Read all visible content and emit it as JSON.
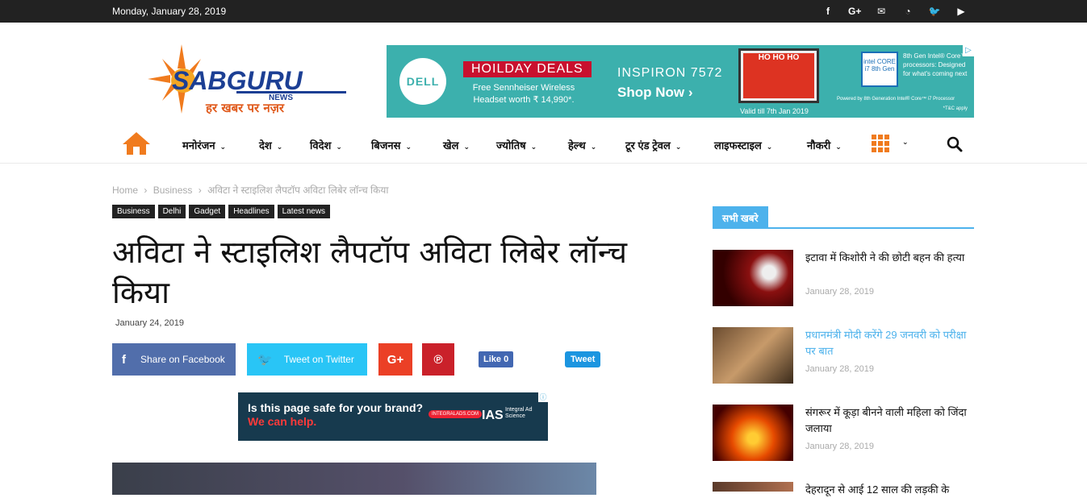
{
  "topbar": {
    "date": "Monday, January 28, 2019",
    "socials": [
      {
        "icon": "facebook-icon",
        "glyph": "f"
      },
      {
        "icon": "google-plus-icon",
        "glyph": "G+"
      },
      {
        "icon": "mail-icon",
        "glyph": "✉"
      },
      {
        "icon": "rss-icon",
        "glyph": "◔"
      },
      {
        "icon": "twitter-icon",
        "glyph": "🐦"
      },
      {
        "icon": "youtube-icon",
        "glyph": "▶"
      }
    ]
  },
  "logo": {
    "name": "SABGURU",
    "sub": "NEWS",
    "tagline": "हर खबर पर नज़र"
  },
  "header_ad": {
    "brand": "DELL",
    "deal": "HOILDAY DEALS",
    "deal_sub": "Free Sennheiser Wireless Headset worth ₹ 14,990*.",
    "model": "INSPIRON 7572",
    "cta": "Shop Now ›",
    "screen_text": "HO HO HO",
    "valid": "Valid till 7th Jan 2019",
    "intel_badge": "intel CORE i7 8th Gen",
    "intel_text": "8th Gen Intel® Core™ processors: Designed for what's coming next",
    "powered": "Powered by 8th Generation Intel® Core™ i7 Processor",
    "tc": "*T&C apply"
  },
  "nav": {
    "items": [
      "मनोरंजन",
      "देश",
      "विदेश",
      "बिजनस",
      "खेल",
      "ज्योतिष",
      "हेल्थ",
      "टूर एंड ट्रेवल",
      "लाइफस्टाइल",
      "नौकरी"
    ],
    "caret": "⌄"
  },
  "breadcrumb": {
    "home": "Home",
    "sep": "›",
    "section": "Business",
    "current": "अविटा ने स्टाइलिश लैपटॉप अविटा लिबेर लॉन्च किया"
  },
  "categories": [
    "Business",
    "Delhi",
    "Gadget",
    "Headlines",
    "Latest news"
  ],
  "article": {
    "title": "अविटा ने स्टाइलिश लैपटॉप अविटा लिबेर लॉन्च किया",
    "date": "January 24, 2019"
  },
  "share": {
    "facebook": "Share on Facebook",
    "twitter": "Tweet on Twitter",
    "gplus_glyph": "G+",
    "pinterest_glyph": "℗",
    "like": "Like 0",
    "tweet": "Tweet"
  },
  "inline_ad": {
    "question": "Is this page safe for your brand?",
    "help": "We can help.",
    "pill": "INTEGRALADS.COM",
    "brand": "IAS",
    "brand_sub": "Integral Ad Science"
  },
  "sidebar": {
    "heading": "सभी खबरे",
    "news": [
      {
        "title": "इटावा में किशोरी ने की छोटी बहन की हत्या",
        "date": "January 28, 2019",
        "highlight": false
      },
      {
        "title": "प्रधानमंत्री मोदी करेंगे 29 जनवरी को परीक्षा पर बात",
        "date": "January 28, 2019",
        "highlight": true
      },
      {
        "title": "संगरूर में कूड़ा बीनने वाली महिला को जिंदा जलाया",
        "date": "January 28, 2019",
        "highlight": false
      },
      {
        "title": "देहरादून से आई 12 साल की लड़की के",
        "date": "",
        "highlight": false
      }
    ]
  },
  "colors": {
    "accent": "#4db2ec",
    "nav_orange": "#f07b1e",
    "facebook": "#516eab",
    "twitter": "#29c5f6",
    "gplus": "#eb4026",
    "pinterest": "#ca212a"
  }
}
